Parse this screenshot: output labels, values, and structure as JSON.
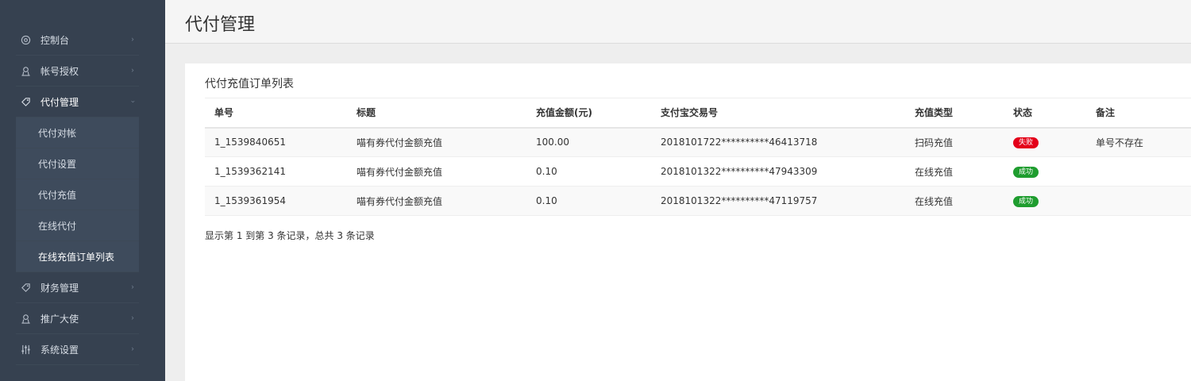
{
  "header": {
    "title": "代付管理"
  },
  "sidebar": {
    "items": [
      {
        "label": "控制台",
        "icon": "dashboard-icon"
      },
      {
        "label": "帐号授权",
        "icon": "user-icon"
      },
      {
        "label": "代付管理",
        "icon": "tag-icon"
      },
      {
        "label": "财务管理",
        "icon": "tag-icon"
      },
      {
        "label": "推广大使",
        "icon": "user-icon"
      },
      {
        "label": "系统设置",
        "icon": "settings-sliders-icon"
      }
    ],
    "submenu": [
      {
        "label": "代付对帐"
      },
      {
        "label": "代付设置"
      },
      {
        "label": "代付充值"
      },
      {
        "label": "在线代付"
      },
      {
        "label": "在线充值订单列表"
      }
    ]
  },
  "panel": {
    "title": "代付充值订单列表",
    "summary": "显示第 1 到第 3 条记录，总共 3 条记录"
  },
  "table": {
    "columns": [
      "单号",
      "标题",
      "充值金额(元)",
      "支付宝交易号",
      "充值类型",
      "状态",
      "备注"
    ],
    "rows": [
      {
        "id": "1_1539840651",
        "title": "喵有券代付金额充值",
        "amount": "100.00",
        "trade_no": "2018101722**********46413718",
        "type": "扫码充值",
        "status": "失败",
        "note": "单号不存在"
      },
      {
        "id": "1_1539362141",
        "title": "喵有券代付金额充值",
        "amount": "0.10",
        "trade_no": "2018101322**********47943309",
        "type": "在线充值",
        "status": "成功",
        "note": ""
      },
      {
        "id": "1_1539361954",
        "title": "喵有券代付金额充值",
        "amount": "0.10",
        "trade_no": "2018101322**********47119757",
        "type": "在线充值",
        "status": "成功",
        "note": ""
      }
    ]
  },
  "colors": {
    "sidebar_bg": "#364150",
    "fail": "#e4001a",
    "success": "#1f9d2f"
  }
}
